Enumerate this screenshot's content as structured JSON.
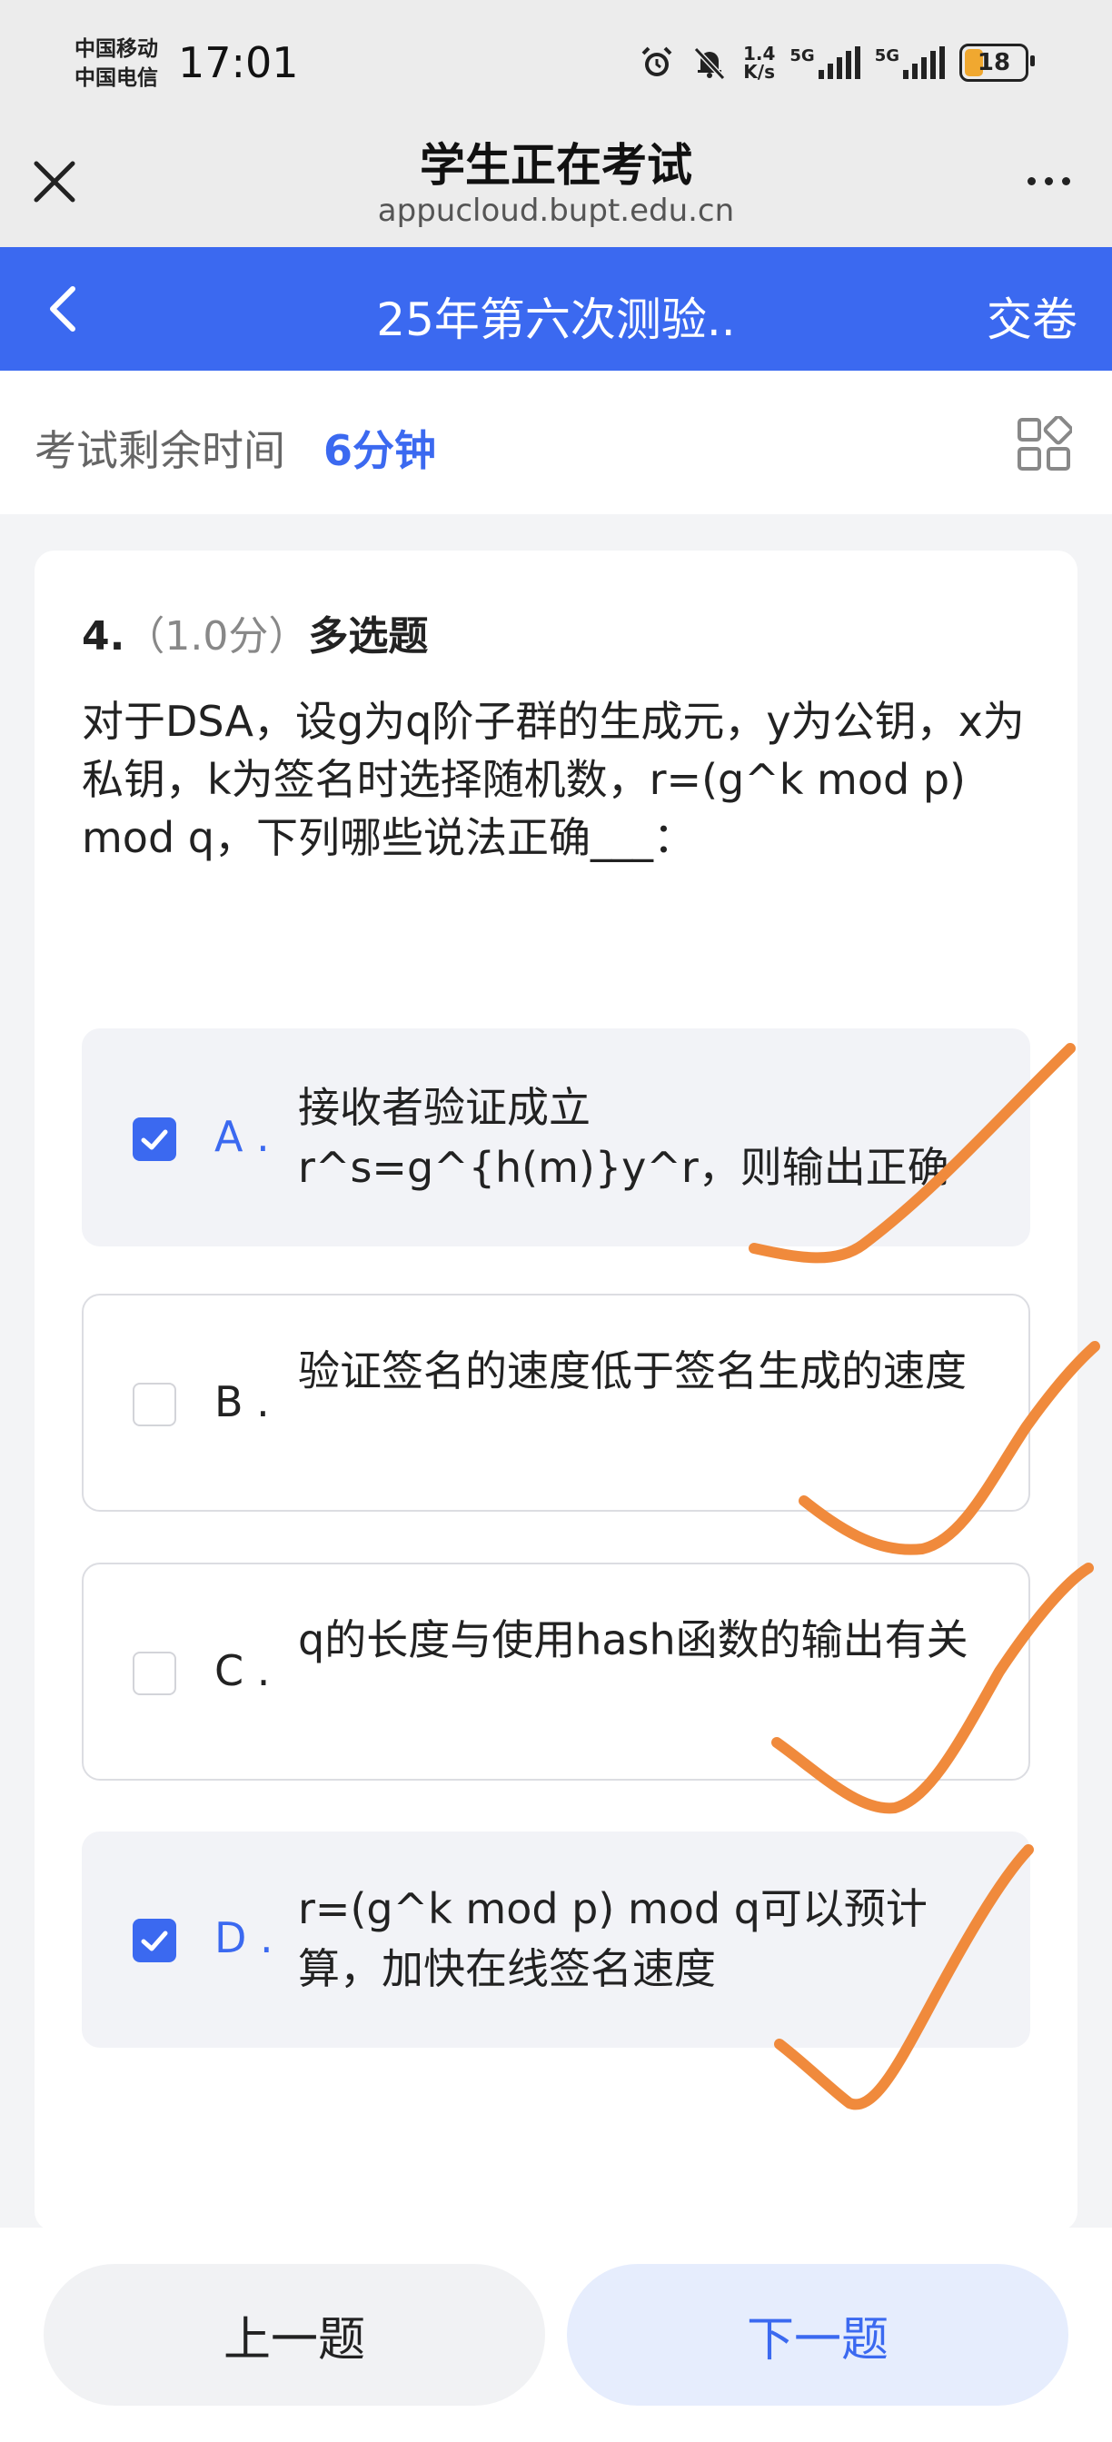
{
  "status_bar": {
    "carrier_1": "中国移动",
    "carrier_2": "中国电信",
    "time": "17:01",
    "net_speed_value": "1.4",
    "net_speed_unit": "K/s",
    "network_1": "5G",
    "network_2": "5G",
    "battery": "18"
  },
  "browser": {
    "title": "学生正在考试",
    "url": "appucloud.bupt.edu.cn"
  },
  "exam": {
    "title": "25年第六次测验..",
    "submit_label": "交卷",
    "timer_label": "考试剩余时间",
    "timer_value": "6分钟"
  },
  "question": {
    "number": "4.",
    "score": "（1.0分）",
    "type": "多选题",
    "text": "对于DSA，设g为q阶子群的生成元，y为公钥，x为私钥，k为签名时选择随机数，r=(g^k mod p) mod q，下列哪些说法正确___：",
    "options": [
      {
        "letter": "A .",
        "text": "接收者验证成立r^s=g^{h(m)}y^r，则输出正确",
        "selected": true
      },
      {
        "letter": "B .",
        "text": "验证签名的速度低于签名生成的速度",
        "selected": false
      },
      {
        "letter": "C .",
        "text": "q的长度与使用hash函数的输出有关",
        "selected": false
      },
      {
        "letter": "D .",
        "text": "r=(g^k mod p) mod q可以预计算，加快在线签名速度",
        "selected": true
      }
    ]
  },
  "nav": {
    "prev_label": "上一题",
    "next_label": "下一题"
  },
  "colors": {
    "accent": "#3b69f0",
    "annotation": "#f08a3c"
  },
  "icons": {
    "close": "close-icon",
    "more": "more-icon",
    "back": "chevron-left-icon",
    "grid": "grid-icon",
    "alarm": "alarm-icon",
    "mute": "bell-off-icon"
  }
}
